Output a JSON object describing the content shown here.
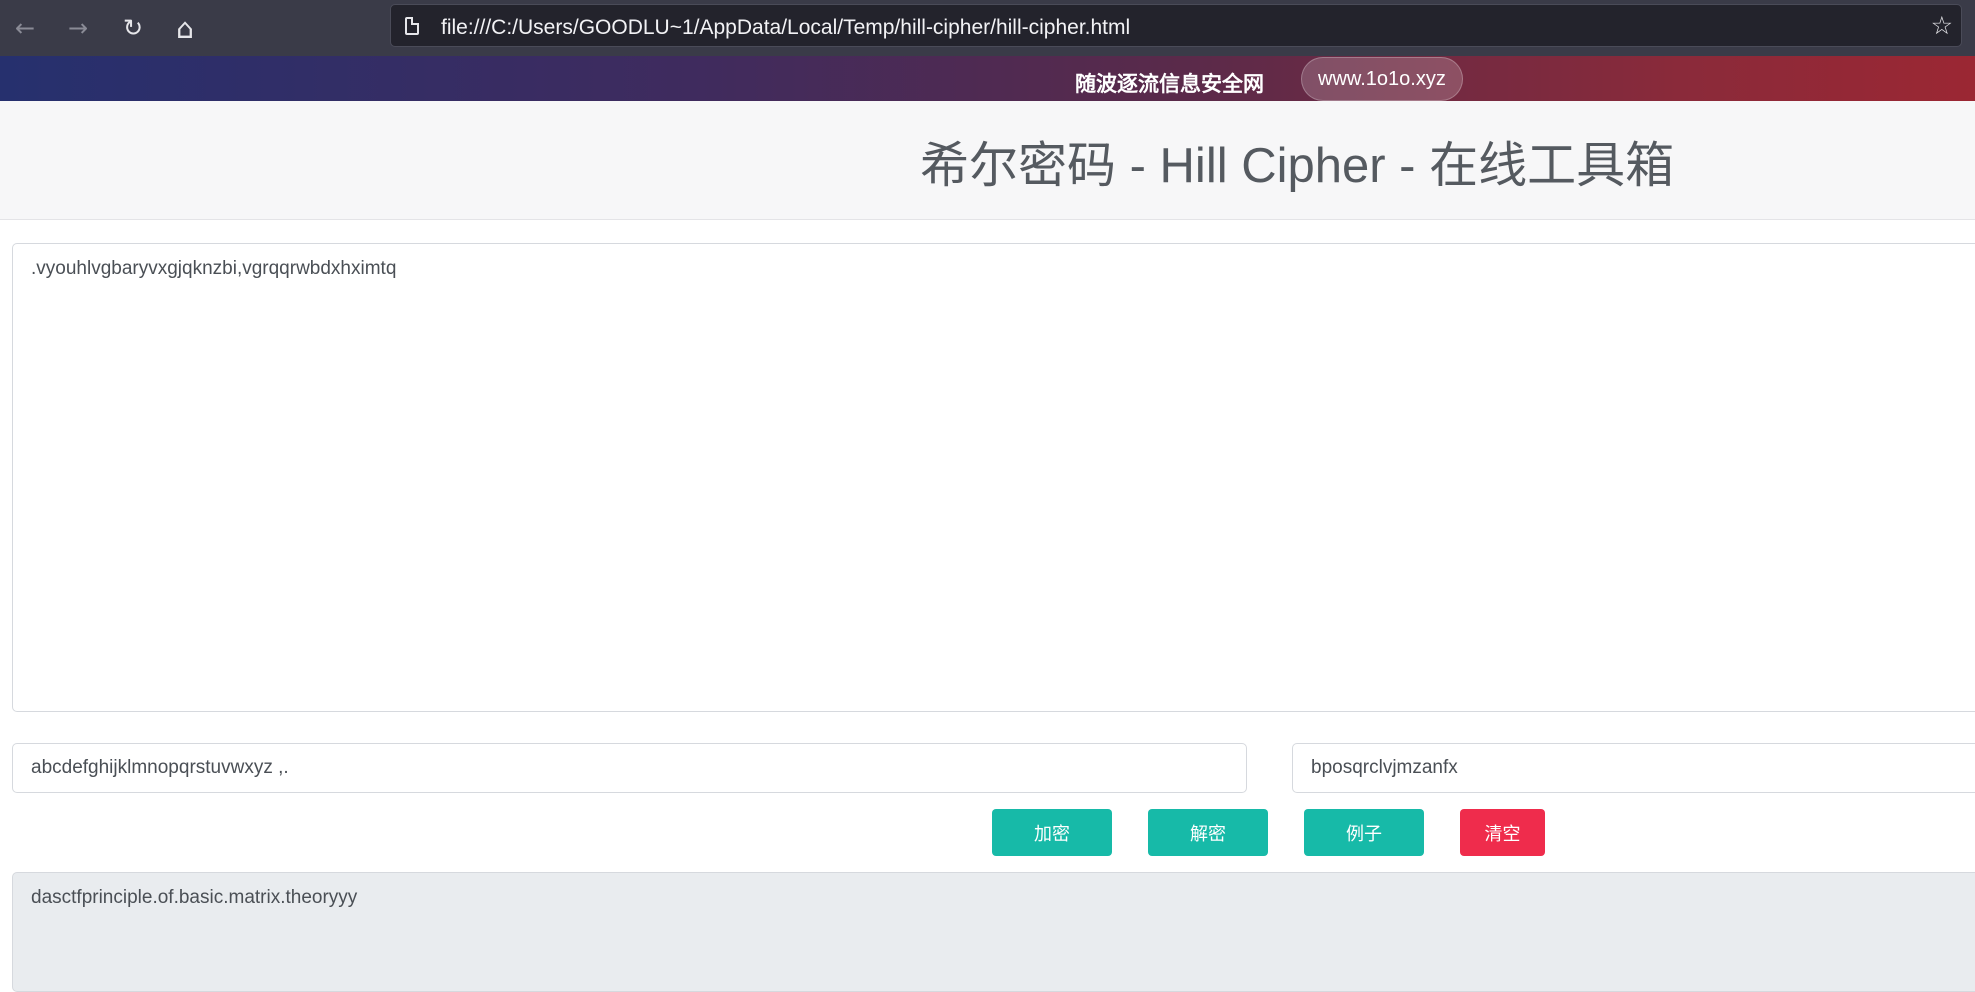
{
  "browser": {
    "back_icon": "←",
    "forward_icon": "→",
    "reload_icon": "↻",
    "home_icon": "⌂",
    "url": "file:///C:/Users/GOODLU~1/AppData/Local/Temp/hill-cipher/hill-cipher.html",
    "star_icon": "☆"
  },
  "banner": {
    "site_name": "随波逐流信息安全网",
    "site_link": "www.1o1o.xyz",
    "gradient_colors": [
      "#26306e",
      "#9b2733"
    ]
  },
  "header": {
    "title": "希尔密码 - Hill Cipher - 在线工具箱"
  },
  "main": {
    "input_text": ".vyouhlvgbaryvxgjqknzbi,vgrqqrwbdxhximtq",
    "alphabet": "abcdefghijklmnopqrstuvwxyz ,.",
    "key": "bposqrclvjmzanfx",
    "buttons": {
      "encrypt": "加密",
      "decrypt": "解密",
      "example": "例子",
      "clear": "清空"
    },
    "output_text": "dasctfprinciple.of.basic.matrix.theoryyy"
  },
  "colors": {
    "button_teal": "#17baa8",
    "button_red": "#ef2c4c"
  }
}
